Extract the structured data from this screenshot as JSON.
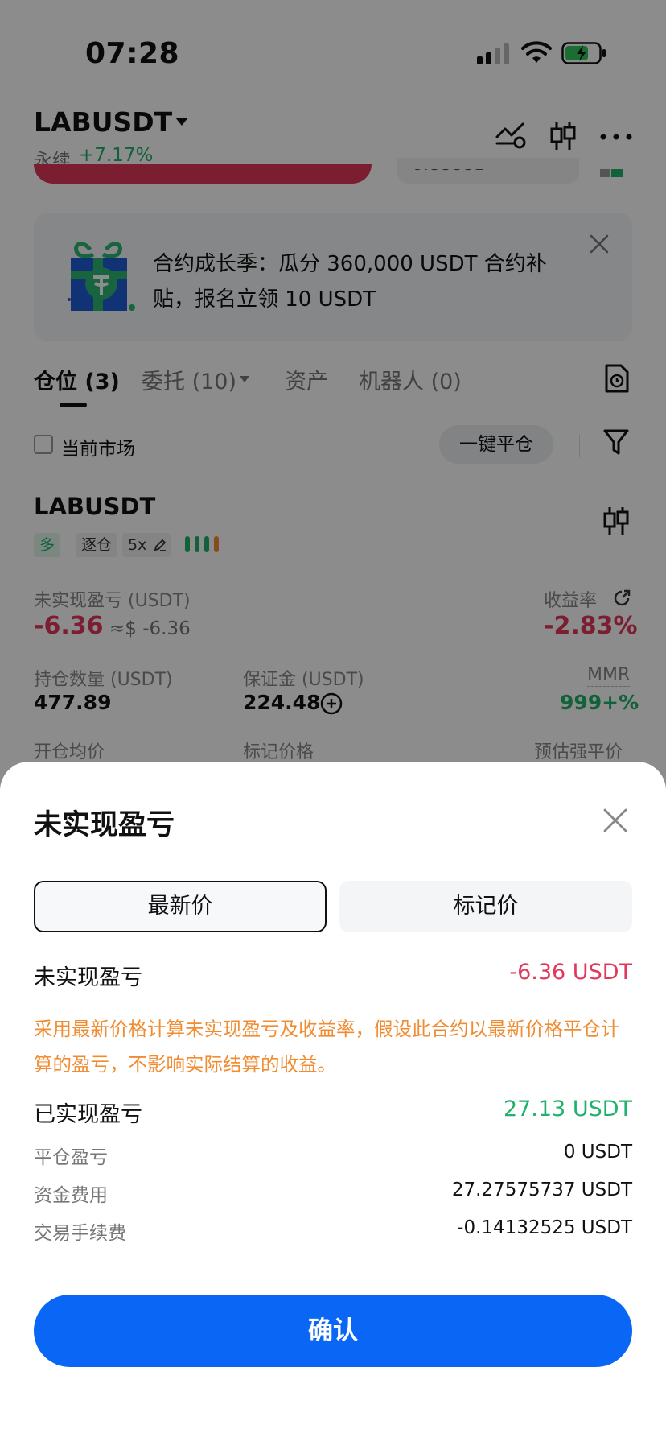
{
  "status_bar": {
    "time": "07:28"
  },
  "header": {
    "symbol": "LABUSDT",
    "contract_type": "永续",
    "change": "+7.17%",
    "ghost_value": "0.88881"
  },
  "banner": {
    "text": "合约成长季：瓜分 360,000 USDT 合约补贴，报名立领 10 USDT"
  },
  "tabs": [
    {
      "label": "仓位 (3)"
    },
    {
      "label": "委托 (10)"
    },
    {
      "label": "资产"
    },
    {
      "label": "机器人 (0)"
    }
  ],
  "filter": {
    "current_market_label": "当前市场",
    "close_all_label": "一键平仓"
  },
  "position": {
    "symbol": "LABUSDT",
    "tags": {
      "side": "多",
      "margin_mode": "逐仓",
      "leverage": "5x"
    },
    "upnl_label": "未实现盈亏 (USDT)",
    "upnl_value": "-6.36",
    "upnl_approx": "≈$ -6.36",
    "roe_label": "收益率",
    "roe_value": "-2.83%",
    "qty_label": "持仓数量 (USDT)",
    "qty_value": "477.89",
    "margin_label": "保证金 (USDT)",
    "margin_value": "224.48",
    "mmr_label": "MMR",
    "mmr_value": "999+%",
    "open_price_label": "开仓均价",
    "mark_price_label": "标记价格",
    "liq_price_label": "预估强平价"
  },
  "sheet": {
    "title": "未实现盈亏",
    "seg_latest": "最新价",
    "seg_mark": "标记价",
    "upnl_label": "未实现盈亏",
    "upnl_value": "-6.36 USDT",
    "note": "采用最新价格计算未实现盈亏及收益率，假设此合约以最新价格平仓计算的盈亏，不影响实际结算的收益。",
    "realized_label": "已实现盈亏",
    "realized_value": "27.13 USDT",
    "rows": [
      {
        "label": "平仓盈亏",
        "value": "0 USDT"
      },
      {
        "label": "资金费用",
        "value": "27.27575737 USDT"
      },
      {
        "label": "交易手续费",
        "value": "-0.14132525 USDT"
      }
    ],
    "confirm_label": "确认"
  },
  "colors": {
    "positive": "#20b26c",
    "negative": "#e0385b",
    "note": "#f08c32",
    "primary_button": "#0a66f5"
  }
}
